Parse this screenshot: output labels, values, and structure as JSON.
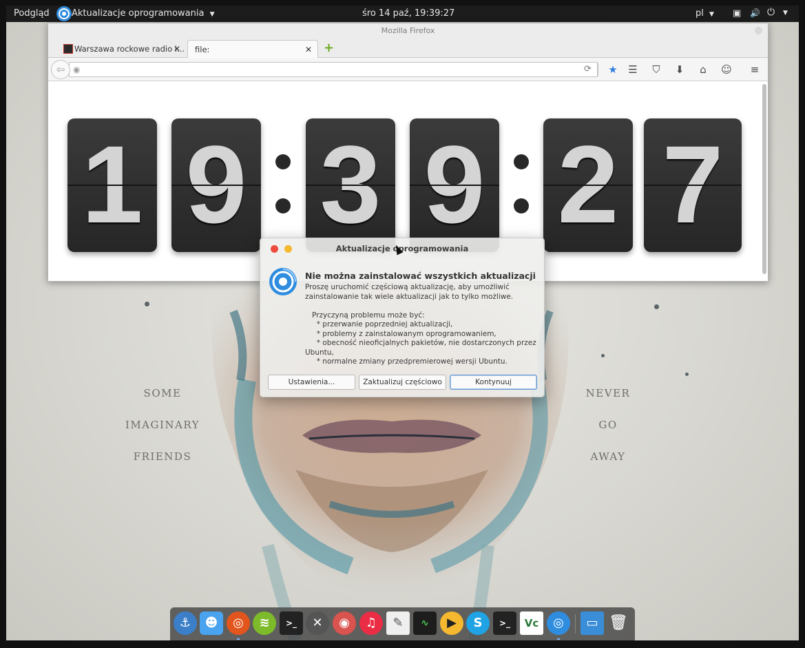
{
  "top_panel": {
    "activities": "Podgląd",
    "app_name": "Aktualizacje oprogramowania",
    "clock": "śro 14 paź, 19:39:27",
    "language": "pl"
  },
  "firefox": {
    "window_title": "Mozilla Firefox",
    "tabs": [
      {
        "label": "Warszawa rockowe radio i..."
      },
      {
        "label": "file:"
      }
    ],
    "url_value": ""
  },
  "clock_digits": [
    "1",
    "9",
    "3",
    "9",
    "2",
    "7"
  ],
  "wallpaper": {
    "left_words": [
      "SOME",
      "IMAGINARY",
      "FRIENDS"
    ],
    "right_words": [
      "NEVER",
      "GO",
      "AWAY"
    ]
  },
  "dialog": {
    "title": "Aktualizacje oprogramowania",
    "heading": "Nie można zainstalować wszystkich aktualizacji",
    "body": "Proszę uruchomić częściową aktualizację, aby umożliwić\nzainstalowanie tak wiele aktualizacji jak to tylko możliwe.\n\n   Przyczyną problemu może być:\n     * przerwanie poprzedniej aktualizacji,\n     * problemy z zainstalowanym oprogramowaniem,\n     * obecność nieoficjalnych pakietów, nie dostarczonych przez\nUbuntu,\n     * normalne zmiany przedpremierowej wersji Ubuntu.",
    "buttons": {
      "settings": "Ustawienia...",
      "partial": "Zaktualizuj częściowo",
      "continue": "Kontynuuj"
    }
  },
  "dock": {
    "icons": [
      "anchor-icon",
      "finder-icon",
      "firefox-icon",
      "spotify-icon",
      "terminal-icon",
      "system-settings-icon",
      "screenshot-icon",
      "music-icon",
      "notes-icon",
      "system-monitor-icon",
      "media-player-icon",
      "skype-icon",
      "terminal-icon",
      "vnc-icon",
      "software-updater-icon",
      "desktop-icon",
      "trash-icon"
    ]
  }
}
